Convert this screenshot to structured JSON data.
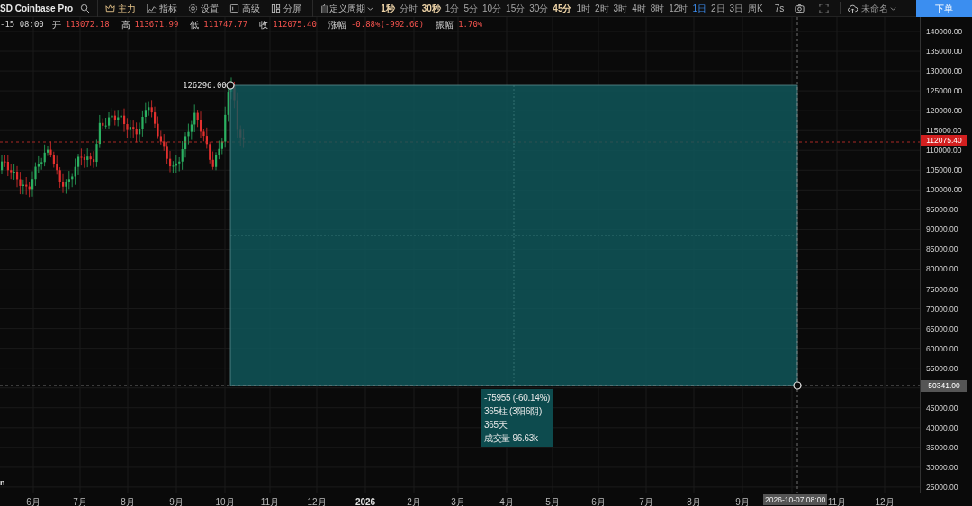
{
  "toolbar": {
    "symbol": "SD Coinbase Pro",
    "tools": [
      {
        "label": "主力",
        "kind": "crown",
        "active": true
      },
      {
        "label": "指标",
        "kind": "chart",
        "active": false
      },
      {
        "label": "设置",
        "kind": "gear",
        "active": false
      },
      {
        "label": "高级",
        "kind": "window",
        "active": false
      },
      {
        "label": "分屏",
        "kind": "split",
        "active": false
      }
    ],
    "period_menu": "自定义周期",
    "periods": [
      {
        "label": "1秒",
        "selected": false,
        "favorite": true
      },
      {
        "label": "分时",
        "selected": false,
        "favorite": false
      },
      {
        "label": "30秒",
        "selected": false,
        "favorite": true
      },
      {
        "label": "1分",
        "selected": false,
        "favorite": false
      },
      {
        "label": "5分",
        "selected": false,
        "favorite": false
      },
      {
        "label": "10分",
        "selected": false,
        "favorite": false
      },
      {
        "label": "15分",
        "selected": false,
        "favorite": false
      },
      {
        "label": "30分",
        "selected": false,
        "favorite": false
      },
      {
        "label": "45分",
        "selected": false,
        "favorite": true
      },
      {
        "label": "1时",
        "selected": false,
        "favorite": false
      },
      {
        "label": "2时",
        "selected": false,
        "favorite": false
      },
      {
        "label": "3时",
        "selected": false,
        "favorite": false
      },
      {
        "label": "4时",
        "selected": false,
        "favorite": false
      },
      {
        "label": "8时",
        "selected": false,
        "favorite": false
      },
      {
        "label": "12时",
        "selected": false,
        "favorite": false
      },
      {
        "label": "1日",
        "selected": true,
        "favorite": false
      },
      {
        "label": "2日",
        "selected": false,
        "favorite": false
      },
      {
        "label": "3日",
        "selected": false,
        "favorite": false
      },
      {
        "label": "周K",
        "selected": false,
        "favorite": false
      }
    ],
    "speed": "7s",
    "layout_name": "未命名",
    "order_button": "下单"
  },
  "ohlc": {
    "date": "-15 08:00",
    "fields": [
      {
        "label": "开",
        "value": "113072.18"
      },
      {
        "label": "高",
        "value": "113671.99"
      },
      {
        "label": "低",
        "value": "111747.77"
      },
      {
        "label": "收",
        "value": "112075.40"
      },
      {
        "label": "涨幅",
        "value": "-0.88%(-992.60)"
      },
      {
        "label": "振幅",
        "value": "1.70%"
      }
    ]
  },
  "chart": {
    "corner_text": "n",
    "high_label": "126296.00",
    "measure": {
      "lines": [
        "-75955 (-60.14%)",
        "365柱 (3阳6阴)",
        "365天",
        "成交量 96.63k"
      ]
    },
    "current_price": "112075.40",
    "crosshair_price": "50341.00",
    "crosshair_time": "2026-10-07 08:00",
    "price_ticks": [
      "140000.00",
      "135000.00",
      "130000.00",
      "125000.00",
      "120000.00",
      "115000.00",
      "110000.00",
      "105000.00",
      "100000.00",
      "95000.00",
      "90000.00",
      "85000.00",
      "80000.00",
      "75000.00",
      "70000.00",
      "65000.00",
      "60000.00",
      "55000.00",
      "45000.00",
      "40000.00",
      "35000.00",
      "30000.00",
      "25000.00"
    ],
    "time_labels": [
      "6月",
      "7月",
      "8月",
      "9月",
      "10月",
      "11月",
      "12月",
      "2026",
      "2月",
      "3月",
      "4月",
      "5月",
      "6月",
      "7月",
      "8月",
      "9月",
      "11月",
      "12月"
    ]
  }
}
